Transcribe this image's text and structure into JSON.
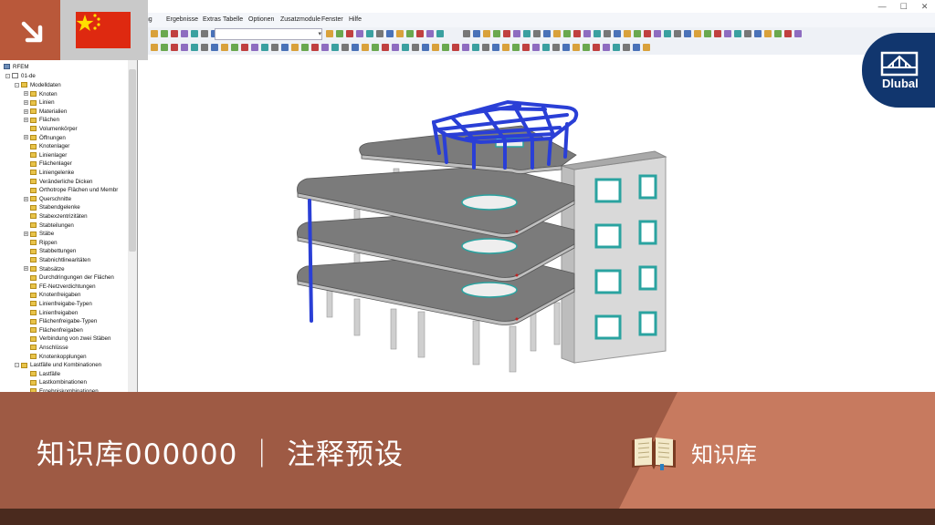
{
  "menubar": {
    "items": [
      "ung",
      "Ergebnisse",
      "Extras",
      "Tabelle",
      "Optionen",
      "Zusatzmodule",
      "Fenster",
      "Hilfe"
    ]
  },
  "window_controls": [
    "—",
    "☐",
    "✕"
  ],
  "navigator": {
    "root_label": "RFEM",
    "project": "01-de",
    "items": [
      {
        "label": "Modelldaten",
        "level": 1,
        "expander": "-"
      },
      {
        "label": "Knoten",
        "level": 2,
        "expander": "+"
      },
      {
        "label": "Linien",
        "level": 2,
        "expander": "+"
      },
      {
        "label": "Materialien",
        "level": 2,
        "expander": "+"
      },
      {
        "label": "Flächen",
        "level": 2,
        "expander": "+"
      },
      {
        "label": "Volumenkörper",
        "level": 2,
        "expander": ""
      },
      {
        "label": "Öffnungen",
        "level": 2,
        "expander": "+"
      },
      {
        "label": "Knotenlager",
        "level": 2,
        "expander": ""
      },
      {
        "label": "Linienlager",
        "level": 2,
        "expander": ""
      },
      {
        "label": "Flächenlager",
        "level": 2,
        "expander": ""
      },
      {
        "label": "Liniengelenke",
        "level": 2,
        "expander": ""
      },
      {
        "label": "Veränderliche Dicken",
        "level": 2,
        "expander": ""
      },
      {
        "label": "Orthotrope Flächen und Membr",
        "level": 2,
        "expander": ""
      },
      {
        "label": "Querschnitte",
        "level": 2,
        "expander": "+"
      },
      {
        "label": "Stabendgelenke",
        "level": 2,
        "expander": ""
      },
      {
        "label": "Stabexzentrizitäten",
        "level": 2,
        "expander": ""
      },
      {
        "label": "Stabteilungen",
        "level": 2,
        "expander": ""
      },
      {
        "label": "Stäbe",
        "level": 2,
        "expander": "+"
      },
      {
        "label": "Rippen",
        "level": 2,
        "expander": ""
      },
      {
        "label": "Stabbettungen",
        "level": 2,
        "expander": ""
      },
      {
        "label": "Stabnichtlinearitäten",
        "level": 2,
        "expander": ""
      },
      {
        "label": "Stabsätze",
        "level": 2,
        "expander": "+"
      },
      {
        "label": "Durchdringungen der Flächen",
        "level": 2,
        "expander": ""
      },
      {
        "label": "FE-Netzverdichtungen",
        "level": 2,
        "expander": ""
      },
      {
        "label": "Knotenfreigaben",
        "level": 2,
        "expander": ""
      },
      {
        "label": "Linienfreigabe-Typen",
        "level": 2,
        "expander": ""
      },
      {
        "label": "Linienfreigaben",
        "level": 2,
        "expander": ""
      },
      {
        "label": "Flächenfreigabe-Typen",
        "level": 2,
        "expander": ""
      },
      {
        "label": "Flächenfreigaben",
        "level": 2,
        "expander": ""
      },
      {
        "label": "Verbindung von zwei Stäben",
        "level": 2,
        "expander": ""
      },
      {
        "label": "Anschlüsse",
        "level": 2,
        "expander": ""
      },
      {
        "label": "Knotenkopplungen",
        "level": 2,
        "expander": ""
      },
      {
        "label": "Lastfälle und Kombinationen",
        "level": 1,
        "expander": "-"
      },
      {
        "label": "Lastfälle",
        "level": 2,
        "expander": ""
      },
      {
        "label": "Lastkombinationen",
        "level": 2,
        "expander": ""
      },
      {
        "label": "Ergebniskombinationen",
        "level": 2,
        "expander": ""
      }
    ]
  },
  "badge": {
    "text": "Dlubal"
  },
  "banner": {
    "title": "知识库000000 ｜ 注释预设",
    "kb_label": "知识库"
  },
  "colors": {
    "banner": "#9e5a44",
    "banner_accent": "#c77a5f",
    "badge": "#11366e",
    "flag_red": "#de2910",
    "flag_star": "#ffde00",
    "arrow_box": "#b9583a",
    "steel_blue": "#2a3fd6",
    "slab_gray": "#7b7b7b",
    "column_gray": "#c9c9c9"
  }
}
